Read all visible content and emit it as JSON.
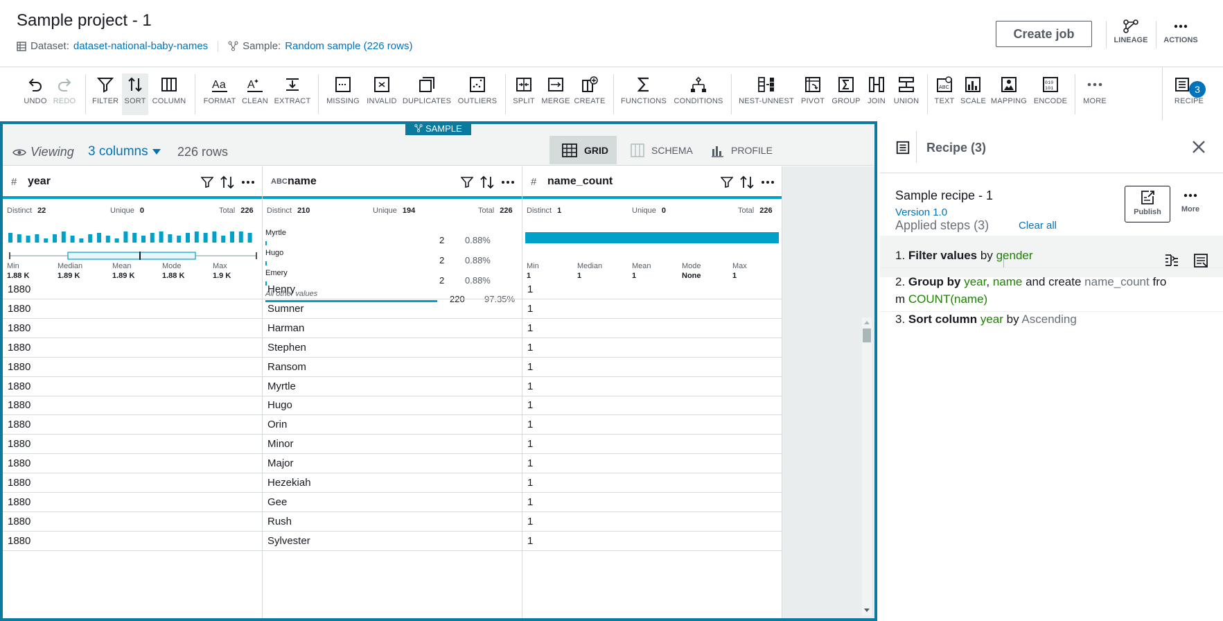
{
  "header": {
    "title": "Sample project - 1",
    "dataset_label": "Dataset:",
    "dataset_value": "dataset-national-baby-names",
    "sample_label": "Sample:",
    "sample_value": "Random sample (226 rows)",
    "create_job": "Create job",
    "lineage": "LINEAGE",
    "actions": "ACTIONS"
  },
  "toolbar": {
    "undo": "UNDO",
    "redo": "REDO",
    "filter": "FILTER",
    "sort": "SORT",
    "column": "COLUMN",
    "format": "FORMAT",
    "clean": "CLEAN",
    "extract": "EXTRACT",
    "missing": "MISSING",
    "invalid": "INVALID",
    "duplicates": "DUPLICATES",
    "outliers": "OUTLIERS",
    "split": "SPLIT",
    "merge": "MERGE",
    "create": "CREATE",
    "functions": "FUNCTIONS",
    "conditions": "CONDITIONS",
    "nest": "NEST-UNNEST",
    "pivot": "PIVOT",
    "group": "GROUP",
    "join": "JOIN",
    "union": "UNION",
    "text": "TEXT",
    "scale": "SCALE",
    "mapping": "MAPPING",
    "encode": "ENCODE",
    "more": "MORE",
    "recipe": "RECIPE",
    "recipe_count": "3"
  },
  "view": {
    "sample_tag": "SAMPLE",
    "viewing": "Viewing",
    "columns": "3 columns",
    "rows": "226 rows",
    "tabs": [
      "GRID",
      "SCHEMA",
      "PROFILE"
    ]
  },
  "columns": [
    {
      "type": "#",
      "name": "year",
      "distinct_label": "Distinct",
      "distinct": "22",
      "unique_label": "Unique",
      "unique": "0",
      "total_label": "Total",
      "total": "226",
      "min_label": "Min",
      "min": "1.88 K",
      "median_label": "Median",
      "median": "1.89 K",
      "mean_label": "Mean",
      "mean": "1.89 K",
      "mode_label": "Mode",
      "mode": "1.88 K",
      "max_label": "Max",
      "max": "1.9 K"
    },
    {
      "type": "ABC",
      "name": "name",
      "distinct_label": "Distinct",
      "distinct": "210",
      "unique_label": "Unique",
      "unique": "194",
      "total_label": "Total",
      "total": "226",
      "top_values": [
        {
          "label": "Myrtle",
          "count": "2",
          "pct": "0.88%"
        },
        {
          "label": "Hugo",
          "count": "2",
          "pct": "0.88%"
        },
        {
          "label": "Emery",
          "count": "2",
          "pct": "0.88%"
        }
      ],
      "other_label": "All other values",
      "other_count": "220",
      "other_pct": "97.35%"
    },
    {
      "type": "#",
      "name": "name_count",
      "distinct_label": "Distinct",
      "distinct": "1",
      "unique_label": "Unique",
      "unique": "0",
      "total_label": "Total",
      "total": "226",
      "min_label": "Min",
      "min": "1",
      "median_label": "Median",
      "median": "1",
      "mean_label": "Mean",
      "mean": "1",
      "mode_label": "Mode",
      "mode": "None",
      "max_label": "Max",
      "max": "1"
    }
  ],
  "rows": [
    {
      "year": "1880",
      "name": "Henry",
      "name_count": "1"
    },
    {
      "year": "1880",
      "name": "Sumner",
      "name_count": "1"
    },
    {
      "year": "1880",
      "name": "Harman",
      "name_count": "1"
    },
    {
      "year": "1880",
      "name": "Stephen",
      "name_count": "1"
    },
    {
      "year": "1880",
      "name": "Ransom",
      "name_count": "1"
    },
    {
      "year": "1880",
      "name": "Myrtle",
      "name_count": "1"
    },
    {
      "year": "1880",
      "name": "Hugo",
      "name_count": "1"
    },
    {
      "year": "1880",
      "name": "Orin",
      "name_count": "1"
    },
    {
      "year": "1880",
      "name": "Minor",
      "name_count": "1"
    },
    {
      "year": "1880",
      "name": "Major",
      "name_count": "1"
    },
    {
      "year": "1880",
      "name": "Hezekiah",
      "name_count": "1"
    },
    {
      "year": "1880",
      "name": "Gee",
      "name_count": "1"
    },
    {
      "year": "1880",
      "name": "Rush",
      "name_count": "1"
    },
    {
      "year": "1880",
      "name": "Sylvester",
      "name_count": "1"
    }
  ],
  "recipe": {
    "title": "Recipe (3)",
    "name": "Sample recipe - 1",
    "version": "Version 1.0",
    "publish": "Publish",
    "more": "More",
    "applied": "Applied steps (3)",
    "clear_all": "Clear all",
    "steps": [
      {
        "num": "1.",
        "action": "Filter values",
        "by": "by",
        "field": "gender"
      },
      {
        "num": "2.",
        "action": "Group by",
        "f1": "year",
        "comma": ",",
        "f2": "name",
        "mid": "and create",
        "f3": "name_count",
        "from1": "fro",
        "from2": "m",
        "f4": "COUNT(name)"
      },
      {
        "num": "3.",
        "action": "Sort column",
        "field": "year",
        "by": "by",
        "order": "Ascending"
      }
    ]
  },
  "colors": {
    "accent": "#00a1c9",
    "link": "#0073bb",
    "green": "#1d8102"
  }
}
